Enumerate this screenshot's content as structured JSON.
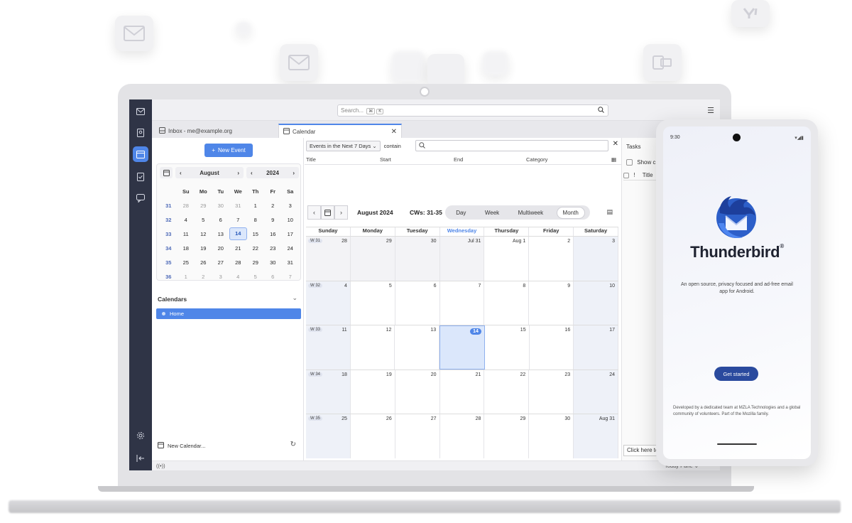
{
  "toolbar": {
    "search_placeholder": "Search...",
    "kbd1": "⌘",
    "kbd2": "K"
  },
  "tabs": [
    {
      "label": "Inbox - me@example.org"
    },
    {
      "label": "Calendar"
    }
  ],
  "left_pane": {
    "new_event": "New Event",
    "mini_cal": {
      "month": "August",
      "year": "2024",
      "weekday_headers": [
        "Su",
        "Mo",
        "Tu",
        "We",
        "Th",
        "Fr",
        "Sa"
      ],
      "weeks": [
        {
          "wk": "31",
          "days": [
            "28",
            "29",
            "30",
            "31",
            "1",
            "2",
            "3"
          ]
        },
        {
          "wk": "32",
          "days": [
            "4",
            "5",
            "6",
            "7",
            "8",
            "9",
            "10"
          ]
        },
        {
          "wk": "33",
          "days": [
            "11",
            "12",
            "13",
            "14",
            "15",
            "16",
            "17"
          ]
        },
        {
          "wk": "34",
          "days": [
            "18",
            "19",
            "20",
            "21",
            "22",
            "23",
            "24"
          ]
        },
        {
          "wk": "35",
          "days": [
            "25",
            "26",
            "27",
            "28",
            "29",
            "30",
            "31"
          ]
        },
        {
          "wk": "36",
          "days": [
            "1",
            "2",
            "3",
            "4",
            "5",
            "6",
            "7"
          ]
        }
      ]
    },
    "calendars_title": "Calendars",
    "calendar_home": "Home",
    "new_calendar": "New Calendar..."
  },
  "main": {
    "filter_select": "Events in the Next 7 Days",
    "filter_contain": "contain",
    "columns": [
      "Title",
      "Start",
      "End",
      "Category"
    ],
    "nav_title": "August 2024",
    "nav_cw": "CWs: 31-35",
    "views": [
      "Day",
      "Week",
      "Multiweek",
      "Month"
    ],
    "active_view": "Month",
    "dow": [
      "Sunday",
      "Monday",
      "Tuesday",
      "Wednesday",
      "Thursday",
      "Friday",
      "Saturday"
    ],
    "weeks": [
      {
        "label": "W 31",
        "days": [
          "28",
          "29",
          "30",
          "Jul 31",
          "Aug 1",
          "2",
          "3"
        ]
      },
      {
        "label": "W 32",
        "days": [
          "4",
          "5",
          "6",
          "7",
          "8",
          "9",
          "10"
        ]
      },
      {
        "label": "W 33",
        "days": [
          "11",
          "12",
          "13",
          "14",
          "15",
          "16",
          "17"
        ]
      },
      {
        "label": "W 34",
        "days": [
          "18",
          "19",
          "20",
          "21",
          "22",
          "23",
          "24"
        ]
      },
      {
        "label": "W 35",
        "days": [
          "25",
          "26",
          "27",
          "28",
          "29",
          "30",
          "Aug 31"
        ]
      }
    ]
  },
  "tasks": {
    "title": "Tasks",
    "show_completed": "Show c",
    "col_flag": "!",
    "col_title": "Title",
    "click_here": "Click here to",
    "today_pane": "Today Pane"
  },
  "phone": {
    "time": "9:30",
    "app_name": "Thunderbird",
    "trademark": "®",
    "tagline": "An open source, privacy focused and ad-free email app for Android.",
    "get_started": "Get started",
    "footer": "Developed by a dedicated team at MZLA Technologies and a global community of volunteers. Part of the Mozilla family."
  },
  "colors": {
    "accent": "#4f86e8",
    "spaces_bar": "#2f3446",
    "phone_button": "#2a4a9e"
  }
}
